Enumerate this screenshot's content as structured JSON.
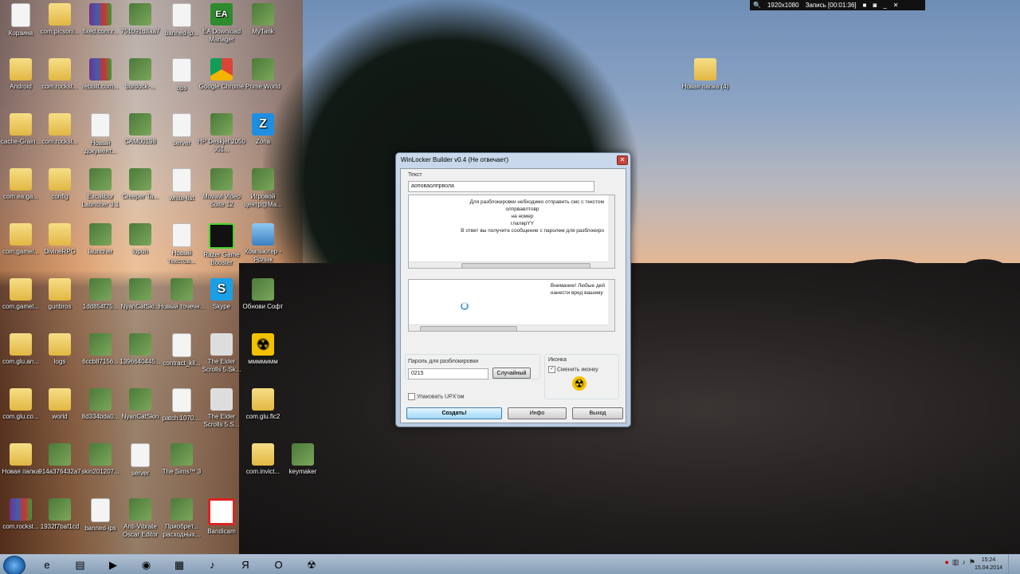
{
  "recorder": {
    "resolution": "1920x1080",
    "recording": "Запись [00:01:36]"
  },
  "desktop_icons": [
    {
      "label": "Корзина",
      "type": "bin"
    },
    {
      "label": "com.picsoni...",
      "type": "folder"
    },
    {
      "label": "fixed.com.r...",
      "type": "rar"
    },
    {
      "label": "751091d8aa7",
      "type": "app"
    },
    {
      "label": "banned-ip...",
      "type": "doc"
    },
    {
      "label": "EA Download Manager",
      "type": "ea"
    },
    {
      "label": "MyTank",
      "type": "app"
    },
    {
      "label": "Android",
      "type": "folder"
    },
    {
      "label": "com.rockst...",
      "type": "folder"
    },
    {
      "label": "rebuilt.com...",
      "type": "rar"
    },
    {
      "label": "burdock-...",
      "type": "app"
    },
    {
      "label": "ops",
      "type": "doc"
    },
    {
      "label": "Google Chrome",
      "type": "chrome"
    },
    {
      "label": "Prime World",
      "type": "app"
    },
    {
      "label": "cache-Grain...",
      "type": "folder"
    },
    {
      "label": "com.rockst...",
      "type": "folder"
    },
    {
      "label": "Новый документ...",
      "type": "doc"
    },
    {
      "label": "CAM00198",
      "type": "app"
    },
    {
      "label": "server",
      "type": "doc"
    },
    {
      "label": "HP Deskjet 2050 J51...",
      "type": "app"
    },
    {
      "label": "Zona",
      "type": "zona"
    },
    {
      "label": "com.ea.ga...",
      "type": "folder"
    },
    {
      "label": "config",
      "type": "folder"
    },
    {
      "label": "Excalibur Launcher 3.1",
      "type": "app"
    },
    {
      "label": "Creeper Ta...",
      "type": "app"
    },
    {
      "label": "white-list",
      "type": "doc"
    },
    {
      "label": "Movavi Video Suite 12",
      "type": "app"
    },
    {
      "label": "Игровой центр@Ma...",
      "type": "app"
    },
    {
      "label": "com.gamel...",
      "type": "folder"
    },
    {
      "label": "DivineRPG",
      "type": "folder"
    },
    {
      "label": "launcher",
      "type": "app"
    },
    {
      "label": "lopuh",
      "type": "app"
    },
    {
      "label": "Новый текстов...",
      "type": "doc"
    },
    {
      "label": "Razer Game Booster",
      "type": "razer"
    },
    {
      "label": "Компьютер - Ярлык",
      "type": "pc"
    },
    {
      "label": "com.gamel...",
      "type": "folder"
    },
    {
      "label": "gunbros",
      "type": "folder"
    },
    {
      "label": "1dd854f75...",
      "type": "app"
    },
    {
      "label": "NyanCatSki...",
      "type": "app"
    },
    {
      "label": "Новый точечн...",
      "type": "app"
    },
    {
      "label": "Skype",
      "type": "skype"
    },
    {
      "label": "Обнови Софт",
      "type": "app"
    },
    {
      "label": "com.glu.an...",
      "type": "folder"
    },
    {
      "label": "logs",
      "type": "folder"
    },
    {
      "label": "6ccb87156...",
      "type": "app"
    },
    {
      "label": "1396640445...",
      "type": "app"
    },
    {
      "label": "contract_kil...",
      "type": "doc"
    },
    {
      "label": "The Elder Scrolls 5.Sk...",
      "type": "sky"
    },
    {
      "label": "ммммимм",
      "type": "nuke"
    },
    {
      "label": "com.glu.co...",
      "type": "folder"
    },
    {
      "label": "world",
      "type": "folder"
    },
    {
      "label": "8d334bda0...",
      "type": "app"
    },
    {
      "label": "NyanCatSkin",
      "type": "app"
    },
    {
      "label": "patch.1070....",
      "type": "doc"
    },
    {
      "label": "The Elder Scrolls 5.S...",
      "type": "sky"
    },
    {
      "label": "com.glu.flc2",
      "type": "folder"
    },
    {
      "label": "Новая папка",
      "type": "folder"
    },
    {
      "label": "914a376432a7",
      "type": "app"
    },
    {
      "label": "skin201207...",
      "type": "app"
    },
    {
      "label": "server",
      "type": "doc"
    },
    {
      "label": "The Sims™ 3",
      "type": "app"
    },
    {
      "label": "keymaker",
      "type": "app"
    },
    {
      "label": "com.invict...",
      "type": "folder"
    },
    {
      "label": "com.rockst...",
      "type": "rar"
    },
    {
      "label": "1932f7baf1cd",
      "type": "app"
    },
    {
      "label": "banned-ips",
      "type": "doc"
    },
    {
      "label": "Anti-Vibrate Oscar Editor",
      "type": "app"
    },
    {
      "label": "Приобрет... расходных...",
      "type": "app"
    },
    {
      "label": "Bandicam",
      "type": "bandi"
    },
    {
      "label": "Новая папка (4)",
      "type": "folder"
    }
  ],
  "dialog": {
    "title": "WinLocker Builder v0.4 (Не отвечает)",
    "close": "✕",
    "text_label": "Текст",
    "text_value": "аоповаолпрвола",
    "message_lines": [
      "Для разблокировки небходимо отправить смс с текстом",
      "олпрвавлтовр",
      "на номер",
      "глалврYY",
      "В ответ вы получите сообщение с паролем для разблокиро"
    ],
    "warning_lines": [
      "Внимание! Любые дей",
      "нанести вред вашему"
    ],
    "password_label": "Пароль для разблокировки",
    "password_value": "0215",
    "random_button": "Случайный",
    "icon_label": "Иконка",
    "change_icon_label": "Сменить иконку",
    "upx_label": "Упаковать UPX'ом",
    "create_button": "Создать!",
    "info_button": "Инфо",
    "exit_button": "Выход"
  },
  "taskbar": {
    "time": "15:24",
    "date": "15.04.2014",
    "apps": [
      {
        "name": "ie-icon",
        "glyph": "e"
      },
      {
        "name": "explorer-icon",
        "glyph": "▤"
      },
      {
        "name": "media-player-icon",
        "glyph": "▶"
      },
      {
        "name": "chrome-icon",
        "glyph": "◉"
      },
      {
        "name": "minecraft-icon",
        "glyph": "▦"
      },
      {
        "name": "sound-icon",
        "glyph": "♪"
      },
      {
        "name": "yandex-icon",
        "glyph": "Я"
      },
      {
        "name": "opera-icon",
        "glyph": "O"
      },
      {
        "name": "winlocker-icon",
        "glyph": "☢"
      }
    ]
  }
}
